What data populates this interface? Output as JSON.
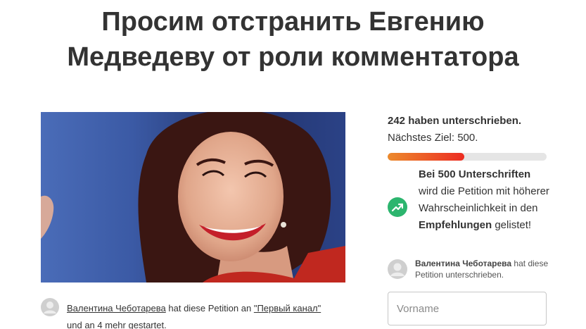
{
  "petition": {
    "title_line1": "Просим отстранить Евгению",
    "title_line2": "Медведеву от роли комментатора"
  },
  "creator": {
    "name": "Валентина Чеботарева",
    "action_text": "hat diese Petition an",
    "recipient": "\"Первый канал\"",
    "and_text": "und",
    "more_link": "an 4 mehr",
    "started_text": "gestartet."
  },
  "signatures": {
    "count_text": "242 haben unterschrieben.",
    "goal_text": "Nächstes Ziel: 500.",
    "progress_fraction": 0.484,
    "progress_colors": [
      "#ec8a2c",
      "#ec2c22"
    ]
  },
  "promo": {
    "part1": "Bei 500 Unterschriften",
    "part2": "wird die Petition mit höherer Wahrscheinlichkeit in den",
    "part3": "Empfehlungen",
    "part4": "gelistet!",
    "icon": "trending-up-icon",
    "icon_color": "#2cb56e"
  },
  "recent_signer": {
    "name": "Валентина Чеботарева",
    "action": "hat diese Petition unterschrieben."
  },
  "form": {
    "first_name_placeholder": "Vorname"
  }
}
